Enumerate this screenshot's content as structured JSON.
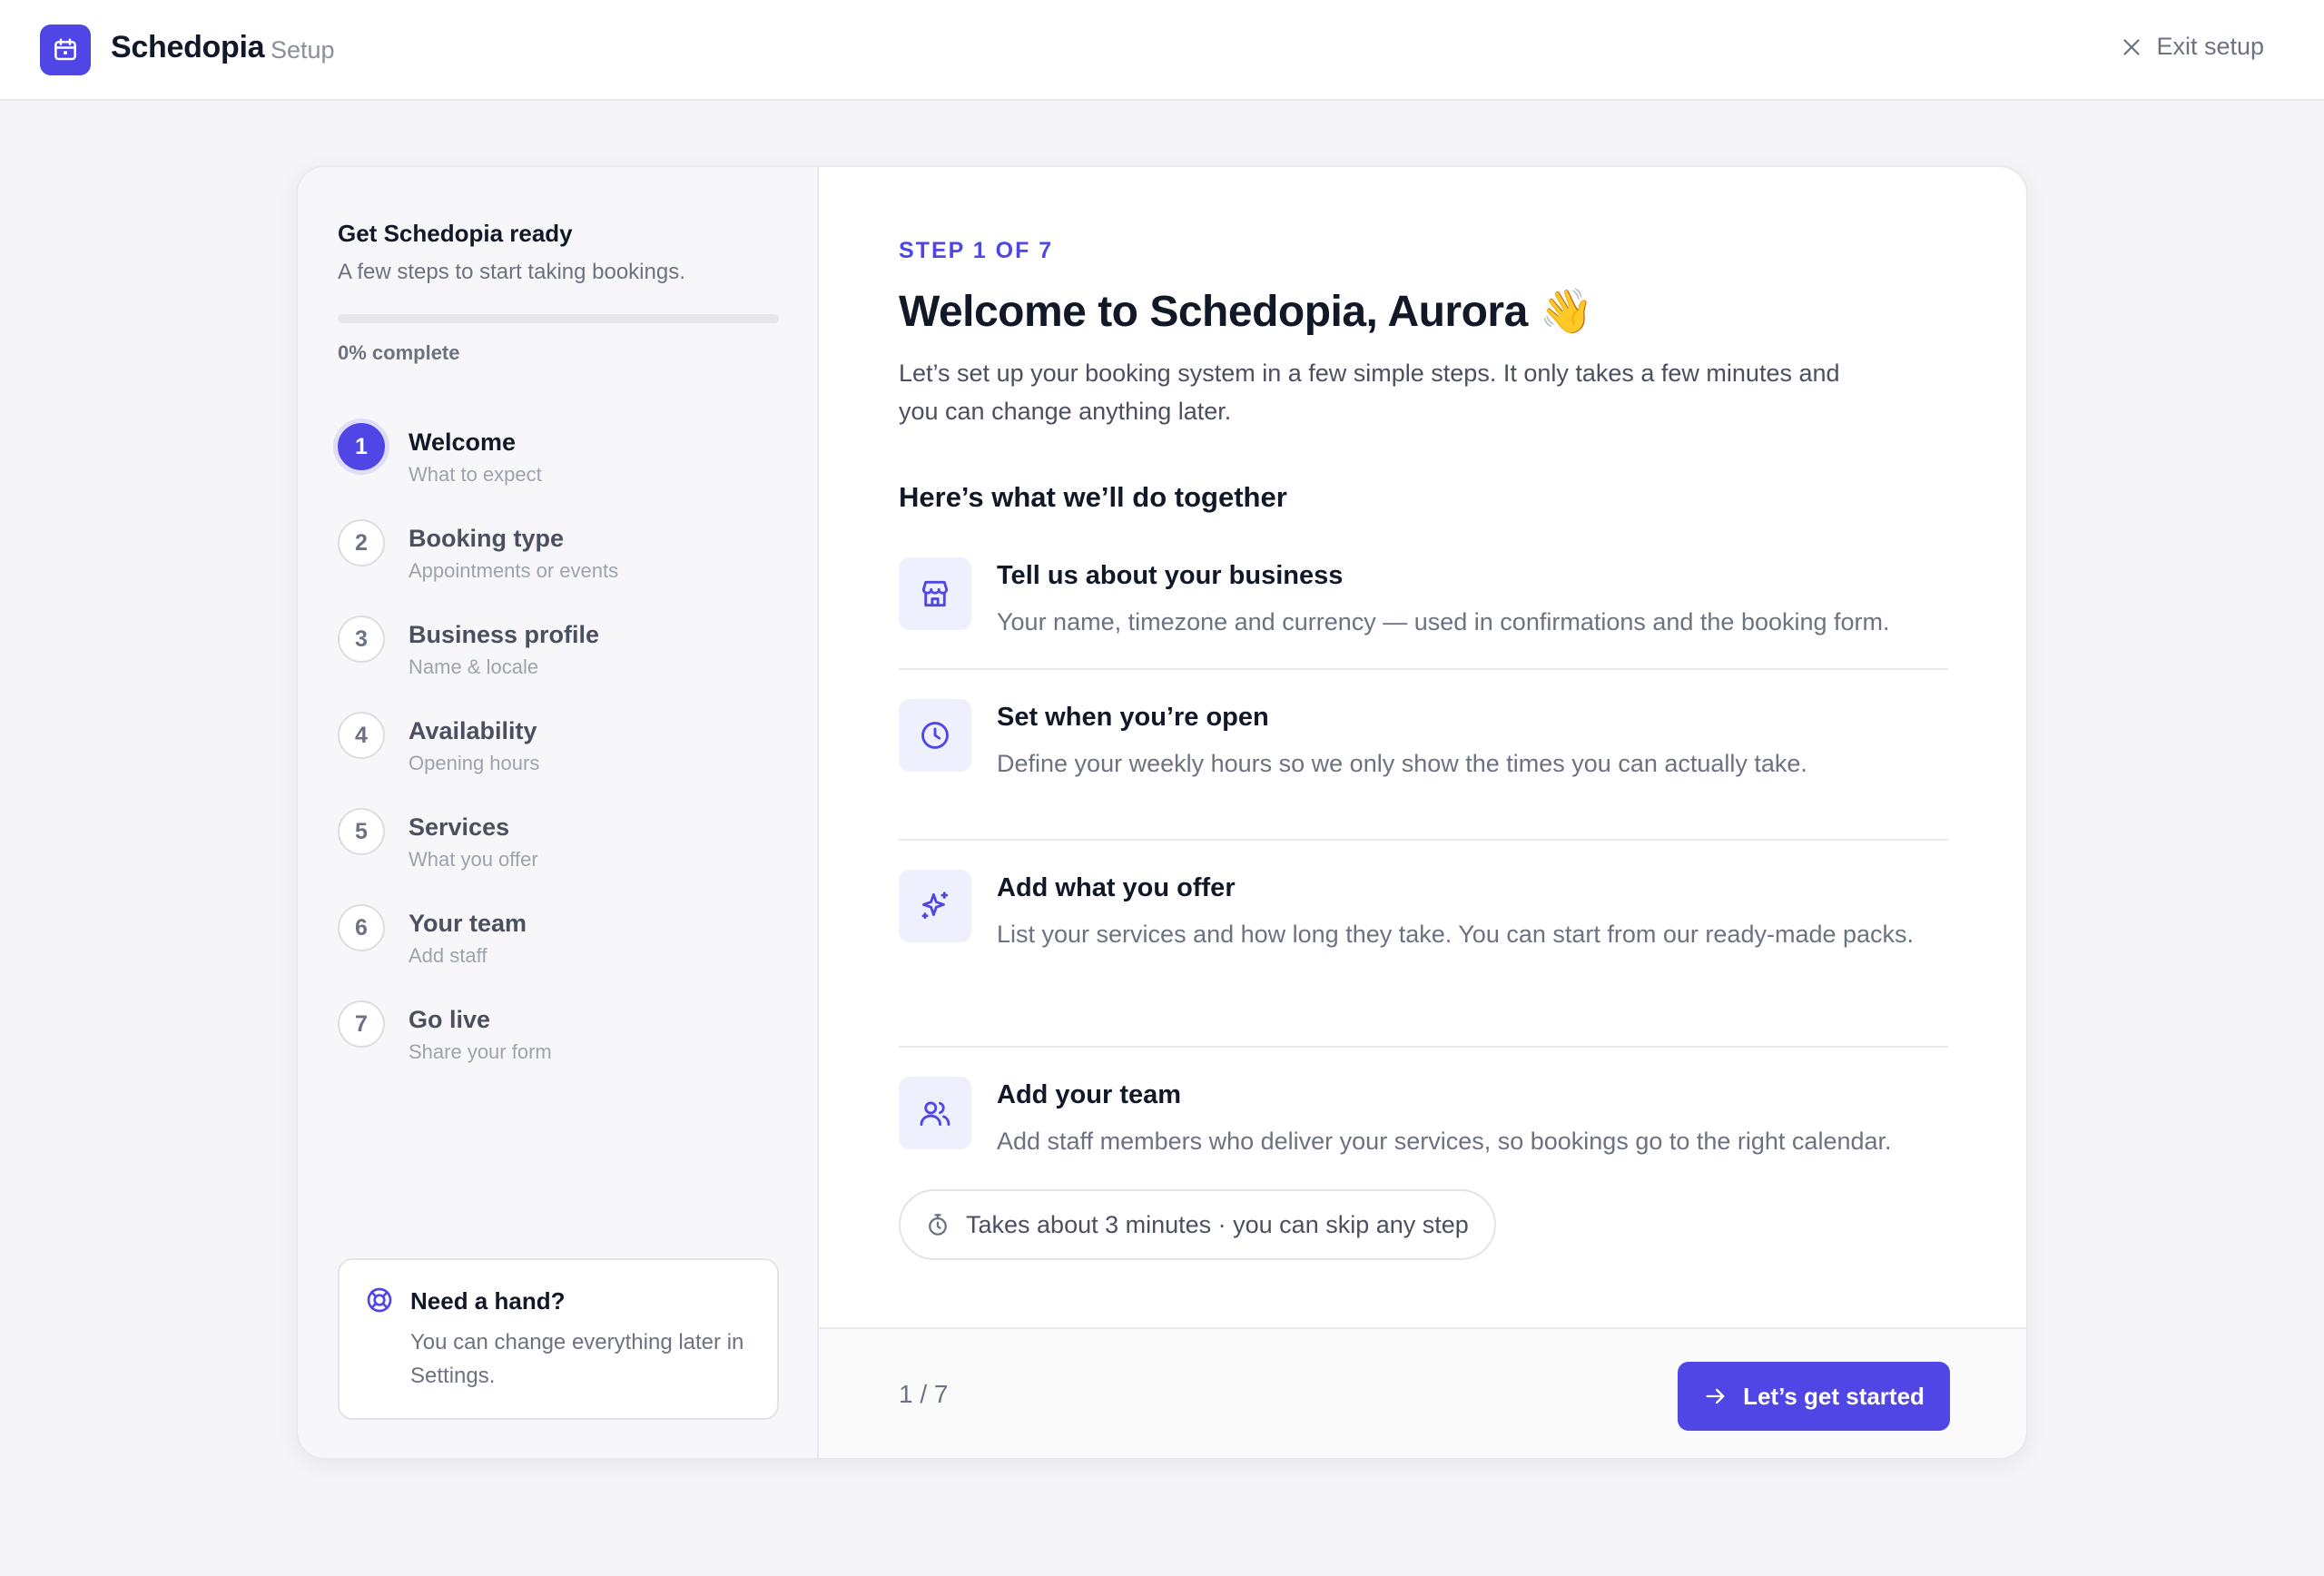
{
  "header": {
    "brand": "Schedopia",
    "section": "Setup",
    "exit_label": "Exit setup"
  },
  "sidebar": {
    "title": "Get Schedopia ready",
    "subtitle": "A few steps to start taking bookings.",
    "progress_percent": 0,
    "progress_label": "0% complete",
    "steps": [
      {
        "number": "1",
        "label": "Welcome",
        "desc": "What to expect",
        "active": true
      },
      {
        "number": "2",
        "label": "Booking type",
        "desc": "Appointments or events"
      },
      {
        "number": "3",
        "label": "Business profile",
        "desc": "Name & locale"
      },
      {
        "number": "4",
        "label": "Availability",
        "desc": "Opening hours"
      },
      {
        "number": "5",
        "label": "Services",
        "desc": "What you offer"
      },
      {
        "number": "6",
        "label": "Your team",
        "desc": "Add staff"
      },
      {
        "number": "7",
        "label": "Go live",
        "desc": "Share your form"
      }
    ],
    "help": {
      "title": "Need a hand?",
      "text": "You can change everything later in Settings."
    }
  },
  "main": {
    "eyebrow": "STEP 1 OF 7",
    "headline": "Welcome to Schedopia, Aurora 👋",
    "intro": "Let’s set up your booking system in a few simple steps. It only takes a few minutes and you can change anything later.",
    "section_title": "Here’s what we’ll do together",
    "items": [
      {
        "icon": "store-icon",
        "title": "Tell us about your business",
        "desc": "Your name, timezone and currency — used in confirmations and the booking form."
      },
      {
        "icon": "clock-icon",
        "title": "Set when you’re open",
        "desc": "Define your weekly hours so we only show the times you can actually take."
      },
      {
        "icon": "sparkles-icon",
        "title": "Add what you offer",
        "desc": "List your services and how long they take. You can start from our ready-made packs."
      },
      {
        "icon": "users-icon",
        "title": "Add your team",
        "desc": "Add staff members who deliver your services, so bookings go to the right calendar."
      }
    ],
    "time_note": "Takes about 3 minutes · you can skip any step"
  },
  "footer": {
    "counter": "1 / 7",
    "cta_label": "Let’s get started"
  },
  "colors": {
    "accent": "#4f46e5",
    "accent_soft": "#eef0fd",
    "background": "#f5f5f7"
  }
}
